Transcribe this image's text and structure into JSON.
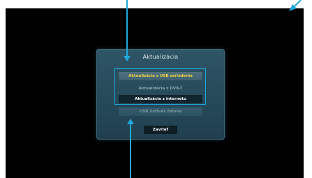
{
  "dialog": {
    "title": "Aktualizácia",
    "options": [
      {
        "label": "Aktualizácia z USB zariadenia",
        "state": "highlighted"
      },
      {
        "label": "Aktualizácia z DVB-T",
        "state": "disabled"
      },
      {
        "label": "Aktualizácia z internetu",
        "state": "selected"
      },
      {
        "label": "USB Softvér Záloha",
        "state": "disabled"
      }
    ],
    "close_label": "Zavrieť"
  },
  "colors": {
    "screen_bg": "#000000",
    "dialog_bg": "#2a4f60",
    "highlight_text": "#f2d83b",
    "callout_accent": "#1fa9df"
  },
  "icons": {
    "top_arrow": "arrow-down-icon",
    "bottom_arrow": "arrow-up-icon",
    "corner_arrow": "diagonal-arrow-icon"
  }
}
